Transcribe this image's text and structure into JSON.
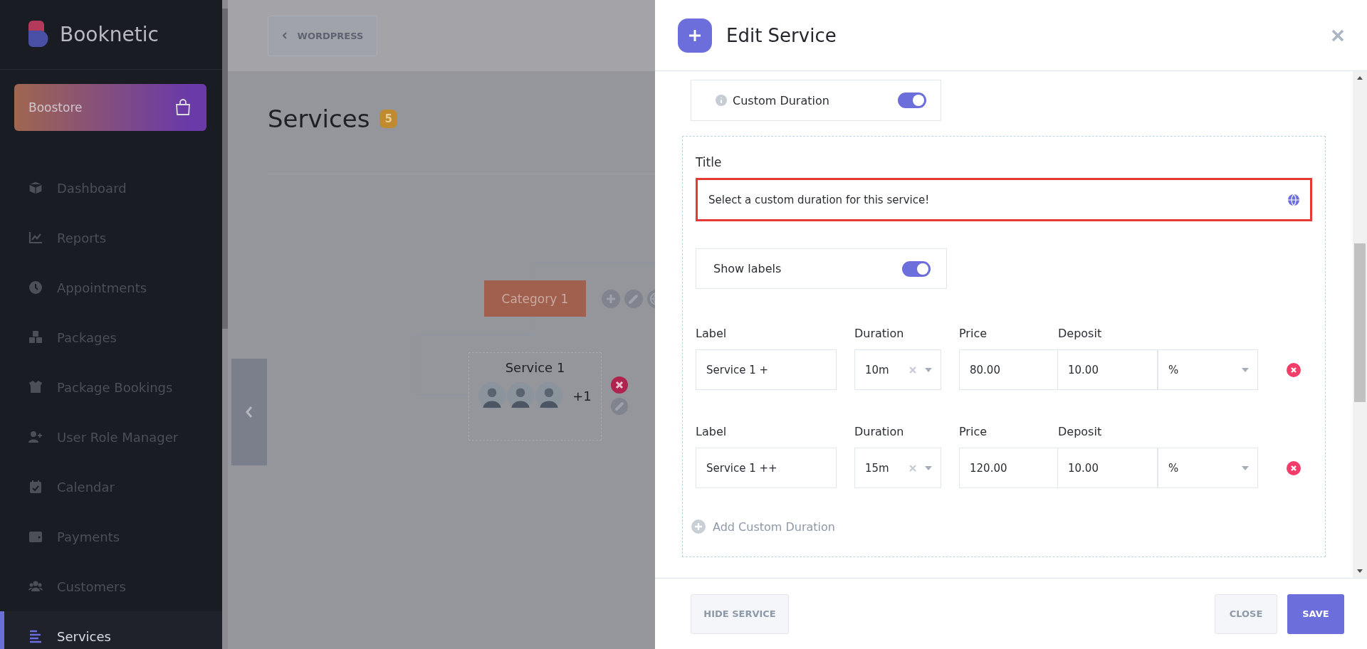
{
  "sidebar": {
    "brand": "Booknetic",
    "store_button": "Boostore",
    "items": [
      {
        "label": "Dashboard",
        "selected": false
      },
      {
        "label": "Reports",
        "selected": false
      },
      {
        "label": "Appointments",
        "selected": false
      },
      {
        "label": "Packages",
        "selected": false
      },
      {
        "label": "Package Bookings",
        "selected": false
      },
      {
        "label": "User Role Manager",
        "selected": false
      },
      {
        "label": "Calendar",
        "selected": false
      },
      {
        "label": "Payments",
        "selected": false
      },
      {
        "label": "Customers",
        "selected": false
      },
      {
        "label": "Services",
        "selected": true
      }
    ]
  },
  "main": {
    "back_button": "WORDPRESS",
    "title": "Services",
    "count": "5",
    "diagram": {
      "category": "Category 1",
      "service": {
        "name": "Service 1",
        "extra_staff": "+1"
      }
    }
  },
  "modal": {
    "title": "Edit Service",
    "custom_duration": {
      "label": "Custom Duration",
      "on": true
    },
    "title_field": {
      "label": "Title",
      "value": "Select a custom duration for this service!",
      "highlighted": true
    },
    "show_labels": {
      "label": "Show labels",
      "on": true
    },
    "durations": [
      {
        "label_caption": "Label",
        "label": "Service 1 +",
        "duration_caption": "Duration",
        "duration": "10m",
        "price_caption": "Price",
        "price": "80.00",
        "deposit_caption": "Deposit",
        "deposit": "10.00",
        "deposit_type": "%"
      },
      {
        "label_caption": "Label",
        "label": "Service 1 ++",
        "duration_caption": "Duration",
        "duration": "15m",
        "price_caption": "Price",
        "price": "120.00",
        "deposit_caption": "Deposit",
        "deposit": "10.00",
        "deposit_type": "%"
      }
    ],
    "add_button": "Add Custom Duration",
    "buttons": {
      "hide": "HIDE SERVICE",
      "close": "CLOSE",
      "save": "SAVE"
    }
  }
}
